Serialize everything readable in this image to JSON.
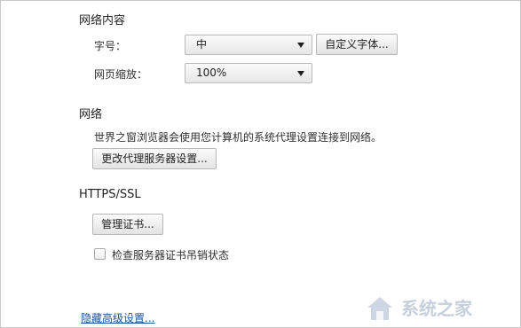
{
  "web_content": {
    "title": "网络内容",
    "font_size_label": "字号：",
    "font_size_value": "中",
    "custom_fonts_button": "自定义字体...",
    "zoom_label": "网页缩放：",
    "zoom_value": "100%"
  },
  "network": {
    "title": "网络",
    "description": "世界之窗浏览器会使用您计算机的系统代理设置连接到网络。",
    "proxy_button": "更改代理服务器设置..."
  },
  "https": {
    "title": "HTTPS/SSL",
    "certs_button": "管理证书...",
    "revocation_checkbox_label": "检查服务器证书吊销状态",
    "revocation_checked": false
  },
  "footer": {
    "hide_advanced_link": "隐藏高级设置..."
  },
  "watermark": {
    "text": "系统之家"
  },
  "colors": {
    "link": "#1f4f9c",
    "text": "#303030"
  }
}
